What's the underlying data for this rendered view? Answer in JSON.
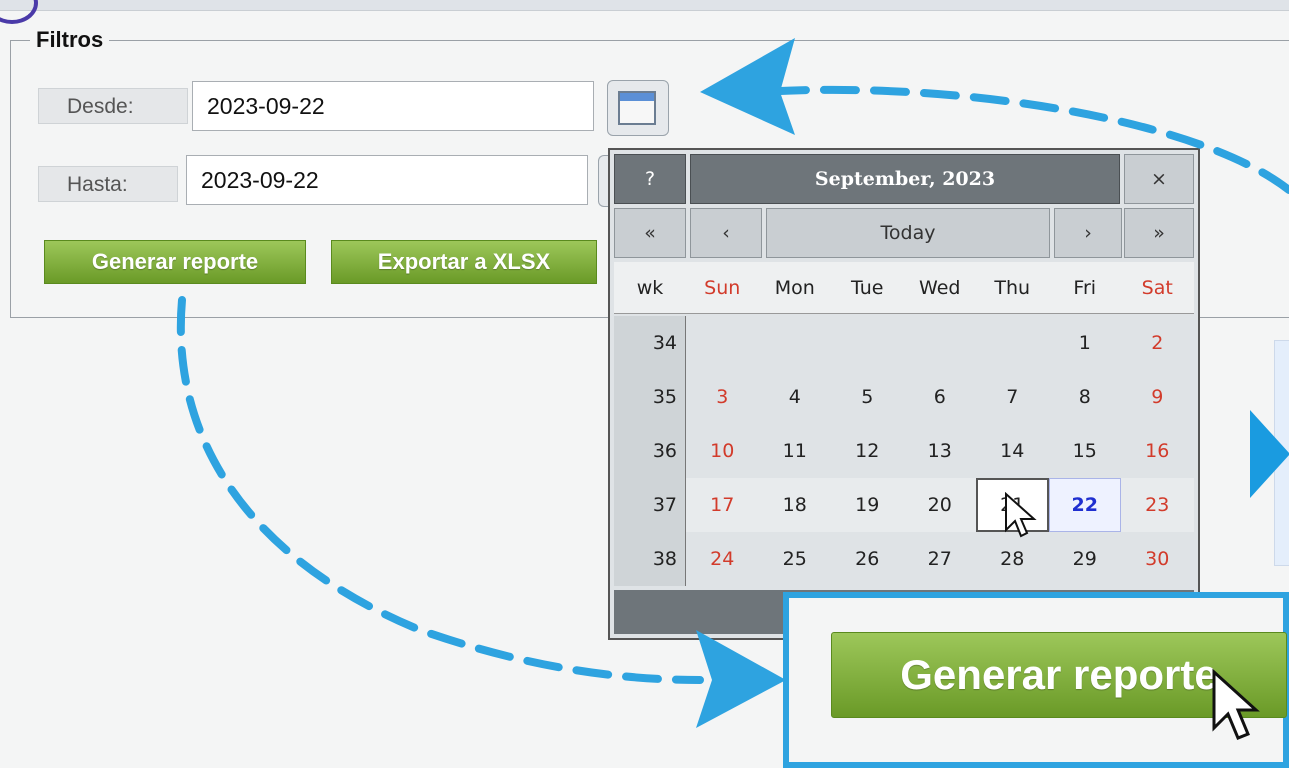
{
  "filters": {
    "legend": "Filtros",
    "desde_label": "Desde:",
    "desde_value": "2023-09-22",
    "hasta_label": "Hasta:",
    "hasta_value": "2023-09-22",
    "generate_button": "Generar reporte",
    "export_button": "Exportar a XLSX"
  },
  "calendar": {
    "help": "?",
    "title": "September, 2023",
    "close": "×",
    "prev_year": "«",
    "prev_month": "‹",
    "today": "Today",
    "next_month": "›",
    "next_year": "»",
    "wk_header": "wk",
    "weekdays": [
      "Sun",
      "Mon",
      "Tue",
      "Wed",
      "Thu",
      "Fri",
      "Sat"
    ],
    "weeks": [
      {
        "wk": "34",
        "days": [
          "",
          "",
          "",
          "",
          "",
          "1",
          "2"
        ]
      },
      {
        "wk": "35",
        "days": [
          "3",
          "4",
          "5",
          "6",
          "7",
          "8",
          "9"
        ]
      },
      {
        "wk": "36",
        "days": [
          "10",
          "11",
          "12",
          "13",
          "14",
          "15",
          "16"
        ]
      },
      {
        "wk": "37",
        "days": [
          "17",
          "18",
          "19",
          "20",
          "21",
          "22",
          "23"
        ]
      },
      {
        "wk": "38",
        "days": [
          "24",
          "25",
          "26",
          "27",
          "28",
          "29",
          "30"
        ]
      }
    ],
    "selected_day": "22"
  },
  "callout": {
    "button": "Generar reporte"
  },
  "colors": {
    "accent_blue": "#2ea3e0",
    "button_green": "#7aaa33",
    "weekend_red": "#d23b2b"
  }
}
